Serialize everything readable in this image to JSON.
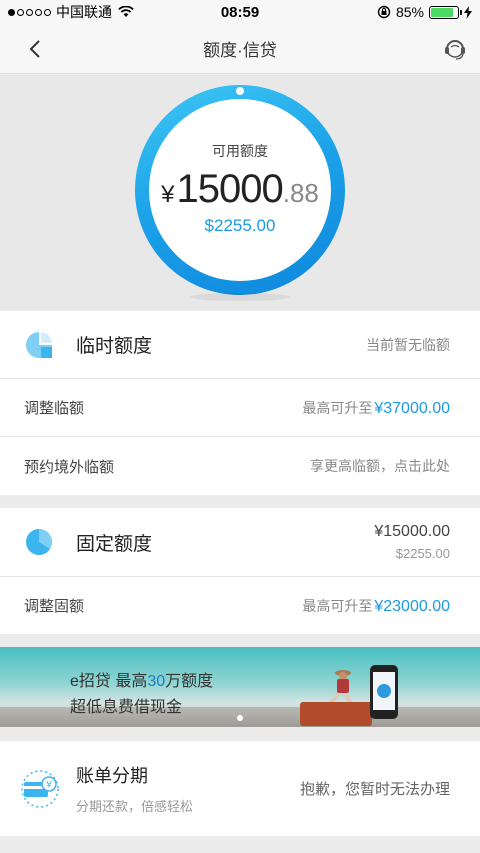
{
  "status_bar": {
    "carrier": "中国联通",
    "time": "08:59",
    "battery": "85%"
  },
  "nav": {
    "title": "额度·信贷"
  },
  "credit": {
    "label": "可用额度",
    "currency_symbol": "¥",
    "amount_integer": "15000",
    "amount_decimal": ".88",
    "usd_amount": "$2255.00"
  },
  "temporary_limit": {
    "title": "临时额度",
    "status": "当前暂无临额",
    "rows": [
      {
        "label": "调整临额",
        "hint": "最高可升至",
        "value": "¥37000.00"
      },
      {
        "label": "预约境外临额",
        "hint": "享更高临额，点击此处"
      }
    ]
  },
  "fixed_limit": {
    "title": "固定额度",
    "cny_amount": "¥15000.00",
    "usd_amount": "$2255.00",
    "rows": [
      {
        "label": "调整固额",
        "hint": "最高可升至",
        "value": "¥23000.00"
      }
    ]
  },
  "banner": {
    "line1_prefix": "e招贷  最高",
    "line1_highlight": "30",
    "line1_suffix": "万额度",
    "line2": "超低息费借现金"
  },
  "installment": {
    "title": "账单分期",
    "subtitle": "分期还款，倍感轻松",
    "status": "抱歉，您暂时无法办理"
  },
  "colors": {
    "accent": "#1a9be0",
    "ring_start": "#3fc8f6",
    "ring_end": "#0f86dc",
    "icon_blue": "#3cb4ee"
  }
}
